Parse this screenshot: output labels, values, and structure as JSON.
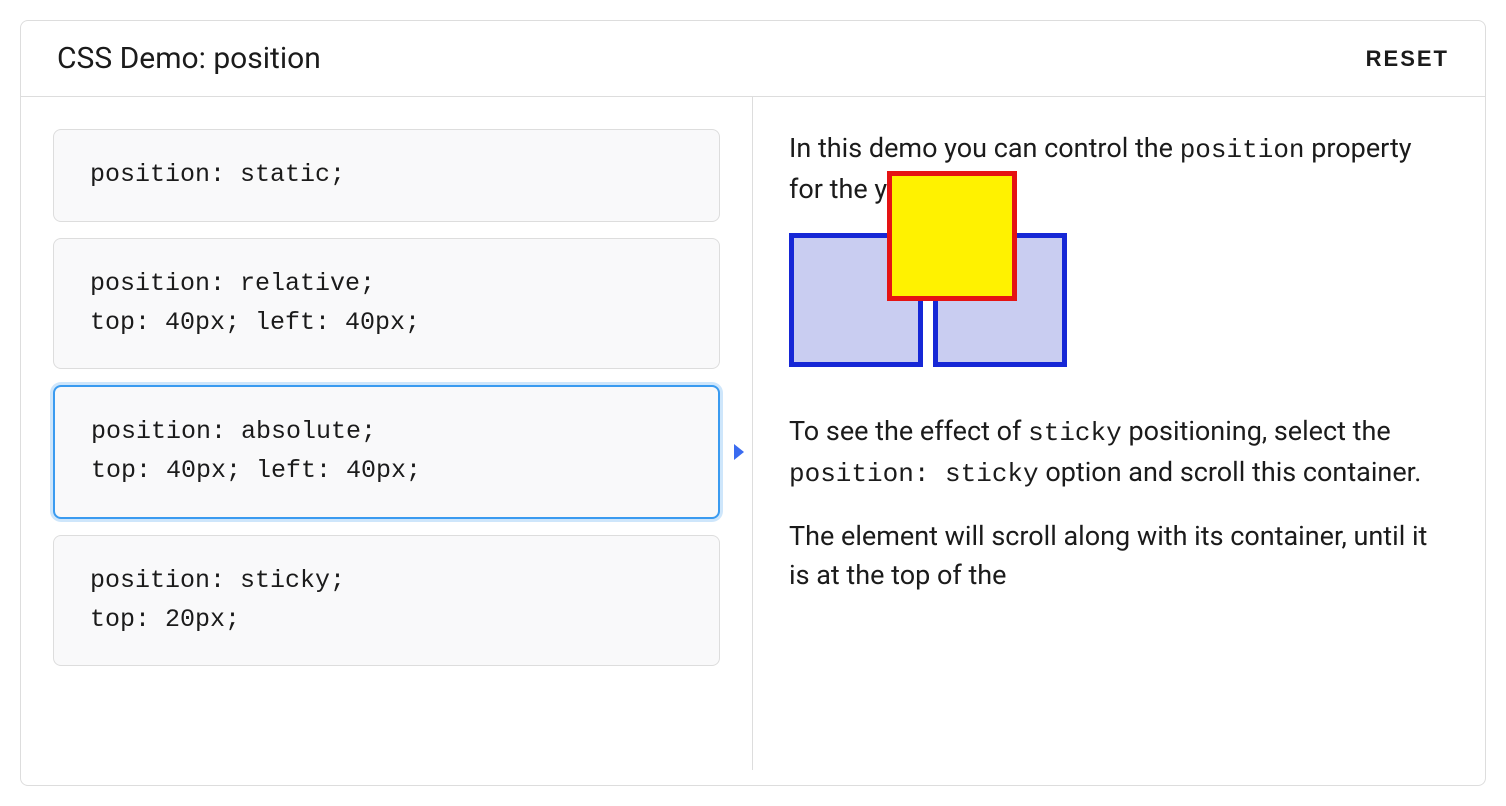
{
  "header": {
    "title": "CSS Demo: position",
    "reset_label": "RESET"
  },
  "options": [
    {
      "code": "position: static;",
      "selected": false
    },
    {
      "code": "position: relative;\ntop: 40px; left: 40px;",
      "selected": false
    },
    {
      "code": "position: absolute;\ntop: 40px; left: 40px;",
      "selected": true
    },
    {
      "code": "position: sticky;\ntop: 20px;",
      "selected": false
    }
  ],
  "output": {
    "para1_pre": "In this demo you can control the ",
    "para1_code": "position",
    "para1_post": " property for the yellow box.",
    "para2_pre": "To see the effect of ",
    "para2_code1": "sticky",
    "para2_mid": " positioning, select the ",
    "para2_code2": "position: sticky",
    "para2_post": " option and scroll this container.",
    "para3": "The element will scroll along with its container, until it is at the top of the"
  }
}
